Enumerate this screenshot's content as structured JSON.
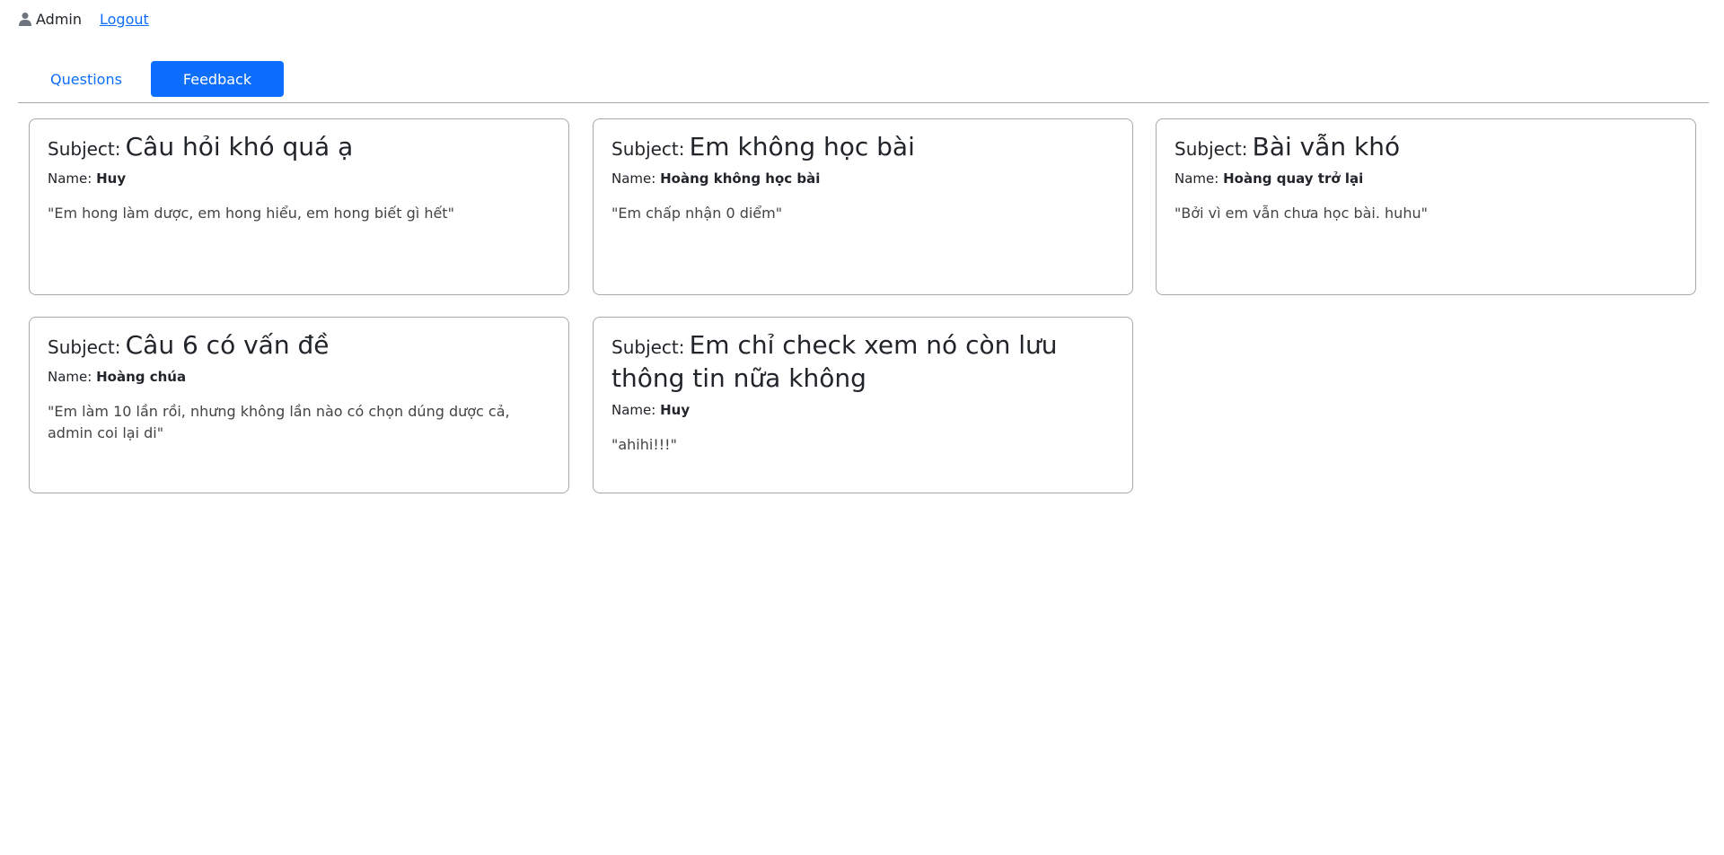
{
  "header": {
    "user_icon": "person-icon",
    "user_label": "Admin",
    "logout_label": "Logout"
  },
  "tabs": [
    {
      "label": "Questions",
      "active": false
    },
    {
      "label": "Feedback",
      "active": true
    }
  ],
  "colors": {
    "accent": "#0d6efd",
    "border": "#a8a8a8"
  },
  "feedback": [
    {
      "subject_label": "Subject:",
      "subject": "Câu hỏi khó quá ạ",
      "name_label": "Name:",
      "name": "Huy",
      "message": "\"Em hong làm dược, em hong hiểu, em hong biết gì hết\""
    },
    {
      "subject_label": "Subject:",
      "subject": "Em không học bài",
      "name_label": "Name:",
      "name": "Hoàng không học bài",
      "message": "\"Em chấp nhận 0 diểm\""
    },
    {
      "subject_label": "Subject:",
      "subject": "Bài vẫn khó",
      "name_label": "Name:",
      "name": "Hoàng quay trở lại",
      "message": "\"Bởi vì em vẫn chưa học bài. huhu\""
    },
    {
      "subject_label": "Subject:",
      "subject": "Câu 6 có vấn đề",
      "name_label": "Name:",
      "name": "Hoàng chúa",
      "message": "\"Em làm 10 lần rồi, nhưng không lần nào có chọn dúng dược cả, admin coi lại di\""
    },
    {
      "subject_label": "Subject:",
      "subject": "Em chỉ check xem nó còn lưu thông tin nữa không",
      "name_label": "Name:",
      "name": "Huy",
      "message": "\"ahihi!!!\""
    }
  ]
}
